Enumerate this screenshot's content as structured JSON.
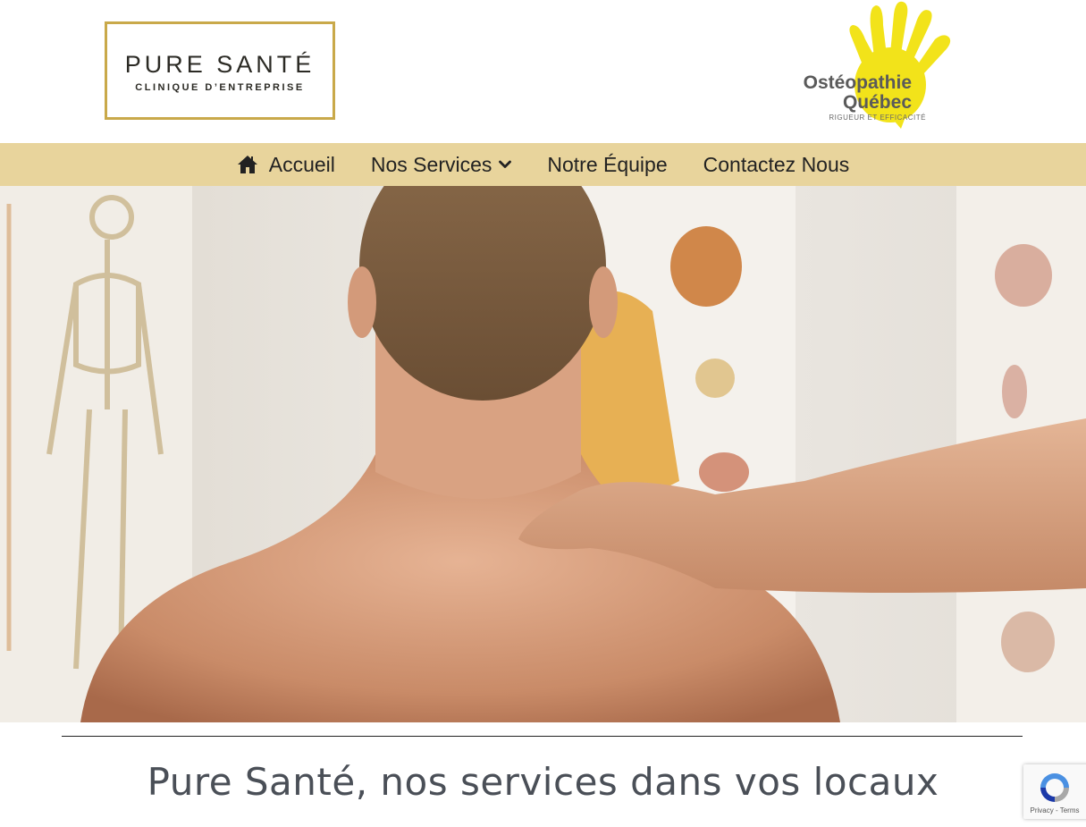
{
  "header": {
    "logo_left": {
      "title": "PURE SANTÉ",
      "subtitle": "CLINIQUE D’ENTREPRISE"
    },
    "logo_right": {
      "name_line1": "Ostéopathie",
      "name_line2": "Québec",
      "tagline": "RIGUEUR ET EFFICACITÉ"
    }
  },
  "nav": {
    "items": [
      {
        "label": "Accueil",
        "icon": "home-icon"
      },
      {
        "label": "Nos Services",
        "icon": "chevron-down-icon"
      },
      {
        "label": "Notre Équipe"
      },
      {
        "label": "Contactez Nous"
      }
    ]
  },
  "hero": {
    "image": "photo of therapist's hand on patient's shoulder in front of anatomy charts"
  },
  "main": {
    "title": "Pure Santé, nos services dans vos locaux"
  },
  "recaptcha": {
    "text": "Privacy - Terms"
  },
  "colors": {
    "nav_bg": "#e8d49c",
    "logo_gold": "#c9a94a",
    "hand_yellow": "#f2e31a",
    "title_text": "#4a4f57"
  }
}
